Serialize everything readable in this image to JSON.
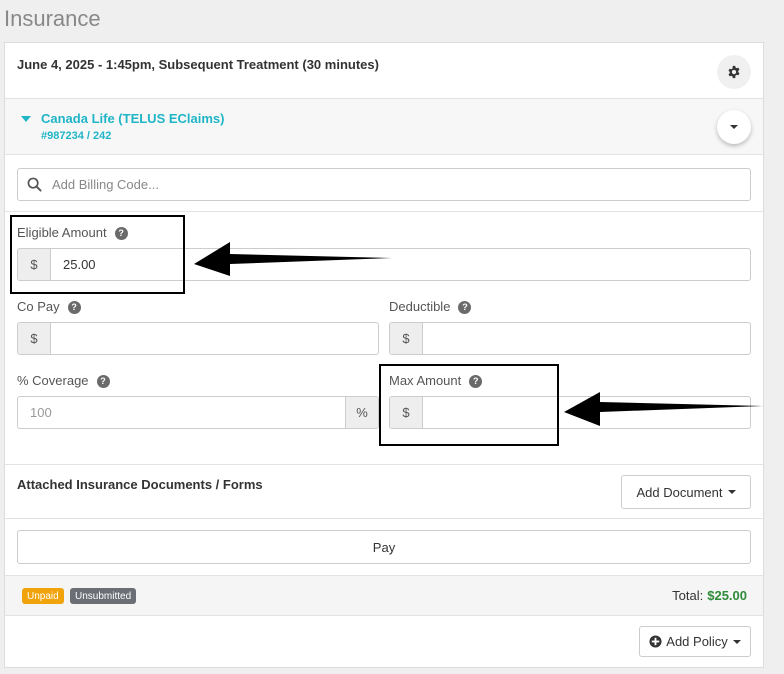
{
  "page": {
    "title": "Insurance"
  },
  "appointment": {
    "title": "June 4, 2025 - 1:45pm, Subsequent Treatment (30 minutes)"
  },
  "policy": {
    "name": "Canada Life (TELUS EClaims)",
    "number": "#987234 / 242"
  },
  "billing": {
    "placeholder": "Add Billing Code..."
  },
  "fields": {
    "eligible_amount": {
      "label": "Eligible Amount",
      "currency": "$",
      "value": "25.00"
    },
    "co_pay": {
      "label": "Co Pay",
      "currency": "$",
      "value": ""
    },
    "deductible": {
      "label": "Deductible",
      "currency": "$",
      "value": ""
    },
    "coverage": {
      "label": "% Coverage",
      "placeholder": "100",
      "suffix": "%"
    },
    "max_amount": {
      "label": "Max Amount",
      "currency": "$",
      "value": ""
    }
  },
  "documents": {
    "title": "Attached Insurance Documents / Forms",
    "add_label": "Add Document"
  },
  "pay": {
    "label": "Pay"
  },
  "status": {
    "badges": [
      {
        "label": "Unpaid",
        "color": "#f0a30a"
      },
      {
        "label": "Unsubmitted",
        "color": "#6b6e75"
      }
    ],
    "total_label": "Total:",
    "total_value": "$25.00"
  },
  "add_policy": {
    "label": "Add Policy"
  },
  "icons": [
    "gear-icon",
    "caret-down-icon",
    "search-icon",
    "help-icon",
    "plus-circle-icon",
    "arrow-icon"
  ],
  "colors": {
    "accent": "#1fb5c7",
    "total": "#2e8b3a",
    "unpaid": "#f0a30a",
    "unsubmitted": "#6b6e75"
  }
}
